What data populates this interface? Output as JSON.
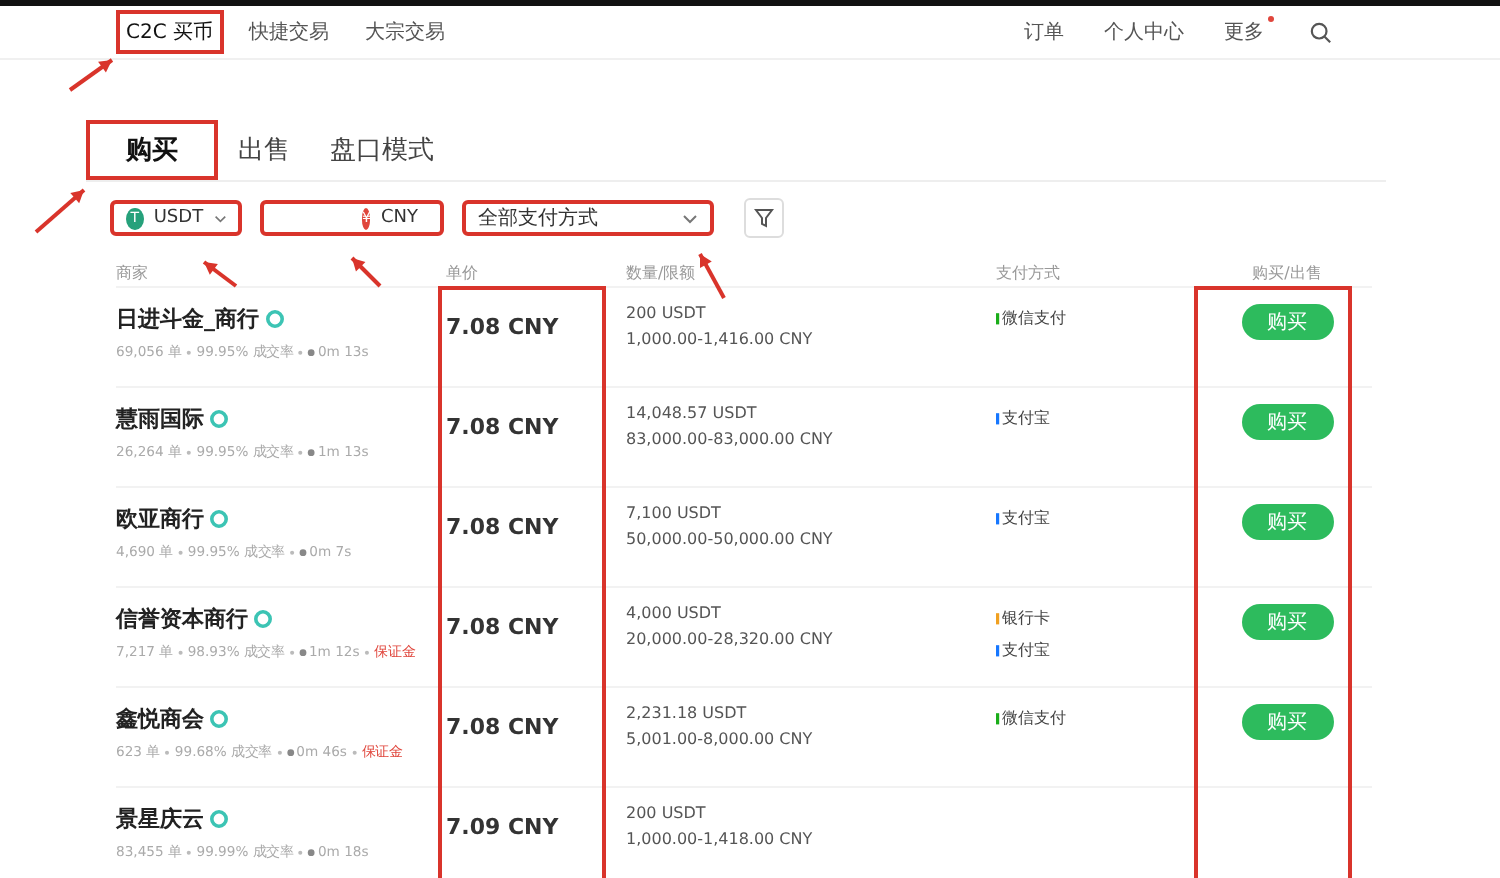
{
  "nav": {
    "items": [
      {
        "label": "C2C 买币",
        "selected": true,
        "highlighted": true
      },
      {
        "label": "快捷交易",
        "selected": false,
        "highlighted": false
      },
      {
        "label": "大宗交易",
        "selected": false,
        "highlighted": false
      }
    ],
    "right_items": [
      {
        "label": "订单",
        "notify": false
      },
      {
        "label": "个人中心",
        "notify": false
      },
      {
        "label": "更多",
        "notify": true
      }
    ]
  },
  "tabs": [
    {
      "label": "购买",
      "selected": true,
      "highlighted": true
    },
    {
      "label": "出售",
      "selected": false,
      "highlighted": false
    },
    {
      "label": "盘口模式",
      "selected": false,
      "highlighted": false
    }
  ],
  "filters": [
    {
      "kind": "coin",
      "badge": "T",
      "color": "#26a17b",
      "value": "USDT",
      "highlighted": true
    },
    {
      "kind": "amount",
      "badge": "¥",
      "color": "#e0463c",
      "value": "CNY",
      "highlighted": true
    },
    {
      "kind": "select",
      "value": "全部支付方式",
      "highlighted": true
    },
    {
      "kind": "funnel",
      "highlighted": false
    }
  ],
  "table": {
    "columns": [
      {
        "label": "商家",
        "highlighted": false
      },
      {
        "label": "单价",
        "highlighted": true
      },
      {
        "label": "数量/限额",
        "highlighted": false
      },
      {
        "label": "支付方式",
        "highlighted": false
      },
      {
        "label": "购买/出售",
        "highlighted": true
      }
    ],
    "rows": [
      {
        "name": "日进斗金_商行",
        "verified": true,
        "orders": "69,056 单",
        "rate": "99.95% 成交率",
        "time": "0m 13s",
        "tag": "",
        "price": "7.08 CNY",
        "quantity": "200 USDT",
        "limit": "1,000.00-1,416.00 CNY",
        "payments": [
          {
            "label": "微信支付",
            "color": "#1aad19"
          }
        ],
        "action": "购买"
      },
      {
        "name": "慧雨国际",
        "verified": true,
        "orders": "26,264 单",
        "rate": "99.95% 成交率",
        "time": "1m 13s",
        "tag": "",
        "price": "7.08 CNY",
        "quantity": "14,048.57 USDT",
        "limit": "83,000.00-83,000.00 CNY",
        "payments": [
          {
            "label": "支付宝",
            "color": "#1677ff"
          }
        ],
        "action": "购买"
      },
      {
        "name": "欧亚商行",
        "verified": true,
        "orders": "4,690 单",
        "rate": "99.95% 成交率",
        "time": "0m 7s",
        "tag": "",
        "price": "7.08 CNY",
        "quantity": "7,100 USDT",
        "limit": "50,000.00-50,000.00 CNY",
        "payments": [
          {
            "label": "支付宝",
            "color": "#1677ff"
          }
        ],
        "action": "购买"
      },
      {
        "name": "信誉资本商行",
        "verified": true,
        "orders": "7,217 单",
        "rate": "98.93% 成交率",
        "time": "1m 12s",
        "tag": "保证金",
        "price": "7.08 CNY",
        "quantity": "4,000 USDT",
        "limit": "20,000.00-28,320.00 CNY",
        "payments": [
          {
            "label": "银行卡",
            "color": "#f0a020"
          },
          {
            "label": "支付宝",
            "color": "#1677ff"
          }
        ],
        "action": "购买"
      },
      {
        "name": "鑫悦商会",
        "verified": true,
        "orders": "623 单",
        "rate": "99.68% 成交率",
        "time": "0m 46s",
        "tag": "保证金",
        "price": "7.08 CNY",
        "quantity": "2,231.18 USDT",
        "limit": "5,001.00-8,000.00 CNY",
        "payments": [
          {
            "label": "微信支付",
            "color": "#1aad19"
          }
        ],
        "action": "购买"
      },
      {
        "name": "景星庆云",
        "verified": true,
        "orders": "83,455 单",
        "rate": "99.99% 成交率",
        "time": "0m 18s",
        "tag": "",
        "price": "7.09 CNY",
        "quantity": "200 USDT",
        "limit": "1,000.00-1,418.00 CNY",
        "payments": [],
        "action": ""
      }
    ]
  }
}
